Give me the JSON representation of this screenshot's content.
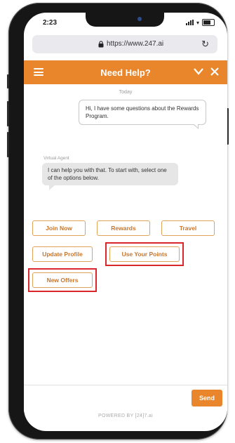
{
  "status_bar": {
    "time": "2:23"
  },
  "browser": {
    "url": "https://www.247.ai"
  },
  "chat": {
    "title": "Need Help?",
    "date_label": "Today",
    "user_message": "Hi, I have some questions about the Rewards Program.",
    "agent_name": "Virtual Agent",
    "agent_message": "I can help you with that. To start with, select one of the options below.",
    "options": [
      "Join Now",
      "Rewards",
      "Travel",
      "Update Profile",
      "Use Your Points",
      "New Offers"
    ],
    "highlighted_options": [
      "Use Your Points",
      "New Offers"
    ]
  },
  "composer": {
    "placeholder": "",
    "send_label": "Send"
  },
  "footer": {
    "powered_by": "POWERED BY [24]7.ai"
  },
  "colors": {
    "accent": "#e9862b",
    "option_border": "#e0a458",
    "highlight": "#d8262a"
  },
  "icons": [
    "menu-icon",
    "lock-icon",
    "refresh-icon",
    "chevron-down-icon",
    "close-icon"
  ]
}
